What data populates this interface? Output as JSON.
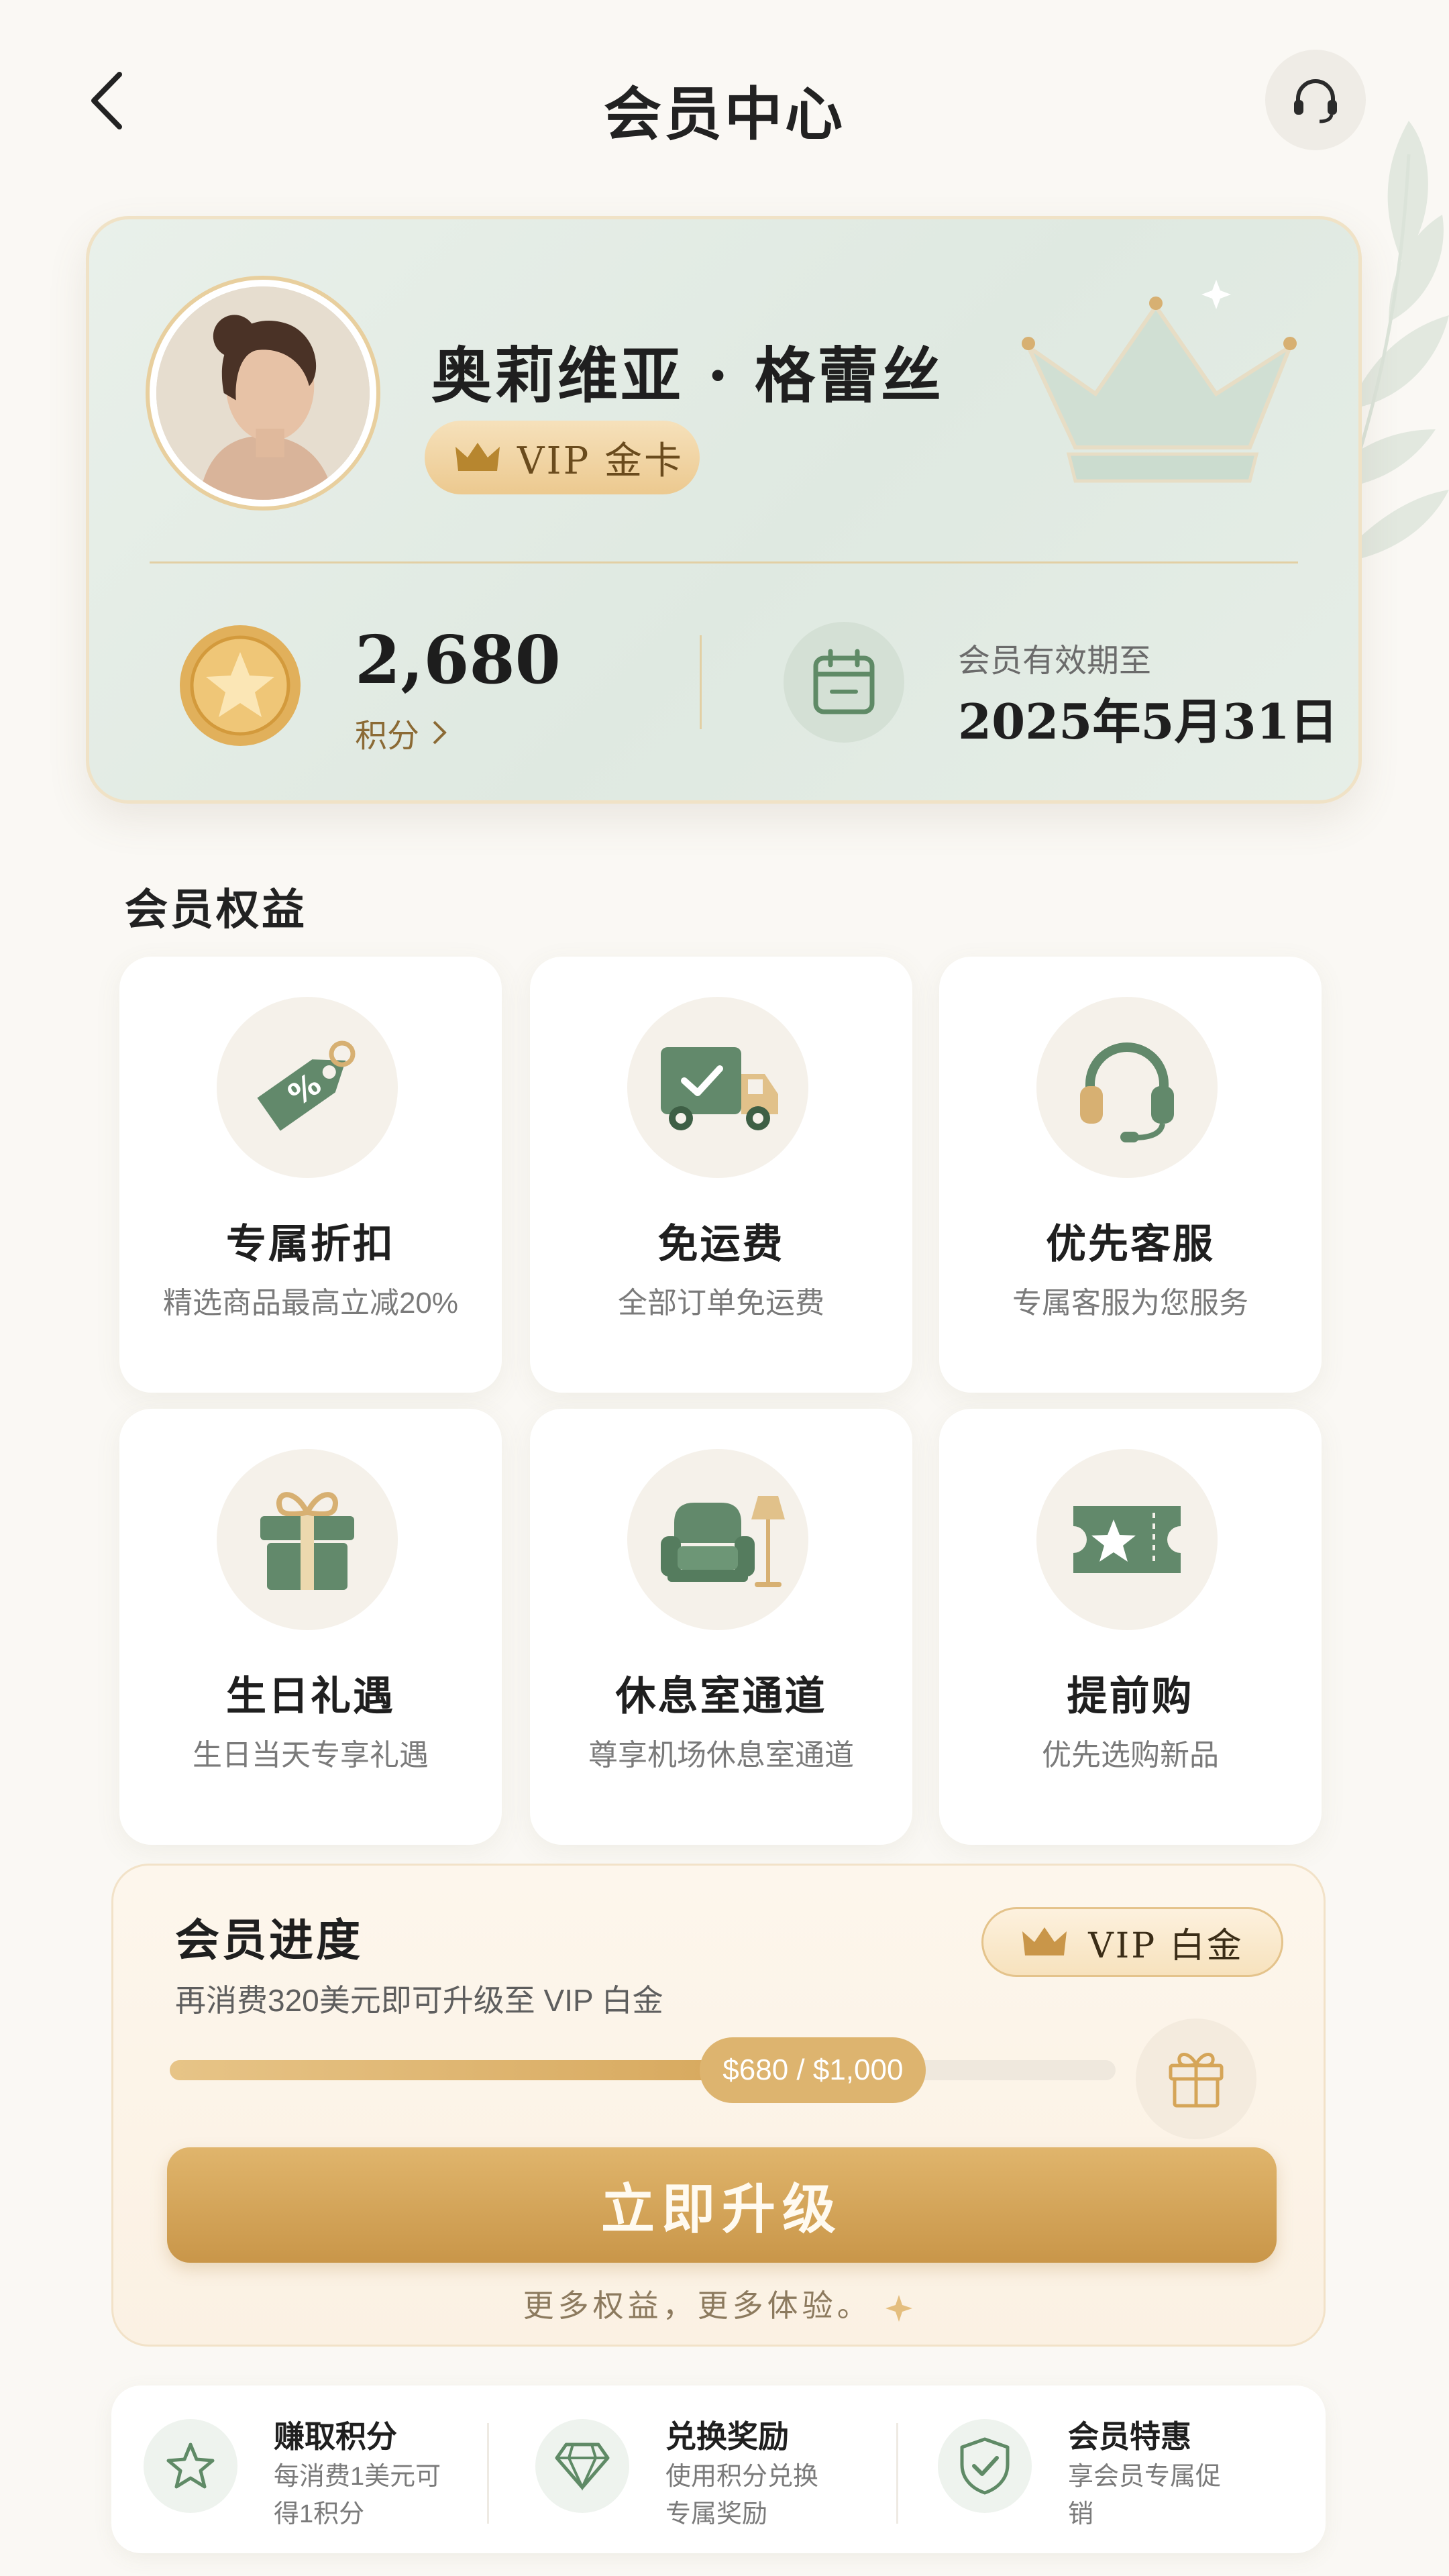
{
  "header": {
    "title": "会员中心",
    "back_icon": "chevron-left-icon",
    "service_icon": "headset-icon"
  },
  "member_card": {
    "name": "奥莉维亚 · 格蕾丝",
    "tier_badge": "VIP  金卡",
    "points_value": "2,680",
    "points_label": "积分",
    "valid_label": "会员有效期至",
    "valid_date": "2025年5月31日"
  },
  "benefits": {
    "title": "会员权益",
    "items": [
      {
        "title": "专属折扣",
        "desc": "精选商品最高立减20%",
        "icon": "discount-tag-icon"
      },
      {
        "title": "免运费",
        "desc": "全部订单免运费",
        "icon": "delivery-truck-icon"
      },
      {
        "title": "优先客服",
        "desc": "专属客服为您服务",
        "icon": "headset-icon"
      },
      {
        "title": "生日礼遇",
        "desc": "生日当天专享礼遇",
        "icon": "gift-icon"
      },
      {
        "title": "休息室通道",
        "desc": "尊享机场休息室通道",
        "icon": "armchair-lamp-icon"
      },
      {
        "title": "提前购",
        "desc": "优先选购新品",
        "icon": "star-ticket-icon"
      }
    ]
  },
  "progress": {
    "title": "会员进度",
    "subtitle": "再消费320美元即可升级至 VIP 白金",
    "next_tier": "VIP  白金",
    "bar_label": "$680 / $1,000",
    "fraction": 0.68,
    "upgrade_button": "立即升级",
    "footer": "更多权益，更多体验。"
  },
  "bottom_links": [
    {
      "title": "赚取积分",
      "desc": "每消费1美元可得1积分",
      "icon": "star-outline-icon"
    },
    {
      "title": "兑换奖励",
      "desc": "使用积分兑换专属奖励",
      "icon": "diamond-icon"
    },
    {
      "title": "会员特惠",
      "desc": "享会员专属促销",
      "icon": "shield-check-icon"
    }
  ],
  "colors": {
    "gold": "#d5a558",
    "green": "#5f8a66",
    "card_bg": "#e3ece4"
  }
}
